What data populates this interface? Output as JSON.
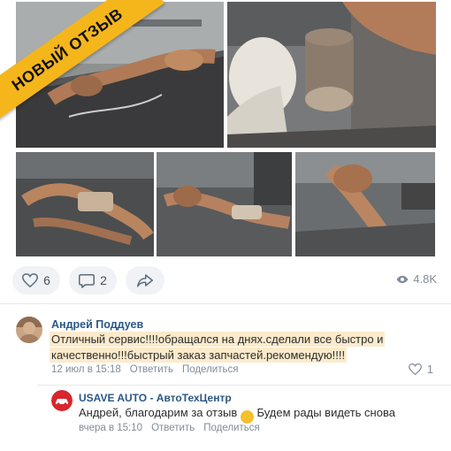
{
  "badge": {
    "label": "НОВЫЙ ОТЗЫВ"
  },
  "colors": {
    "badge": "#f5b61c",
    "link": "#2a5885",
    "highlight": "#fbeacb",
    "muted": "#818c99"
  },
  "post": {
    "likes": "6",
    "comments": "2",
    "views": "4.8K"
  },
  "comment": {
    "author": "Андрей Поддуев",
    "text_line1": "Отличный сервис!!!!обращался на днях.сделали все быстро и",
    "text_line2": "качественно!!!быстрый заказ запчастей.рекомендую!!!!",
    "time": "12 июл в 15:18",
    "reply_label": "Ответить",
    "share_label": "Поделиться",
    "likes": "1"
  },
  "reply": {
    "author": "USAVE AUTO - АвтоТехЦентр",
    "text_before": "Андрей, благодарим за отзыв",
    "emoji": "😊",
    "text_after": "Будем рады видеть снова",
    "time": "вчера в 15:10",
    "reply_label": "Ответить",
    "share_label": "Поделиться"
  }
}
